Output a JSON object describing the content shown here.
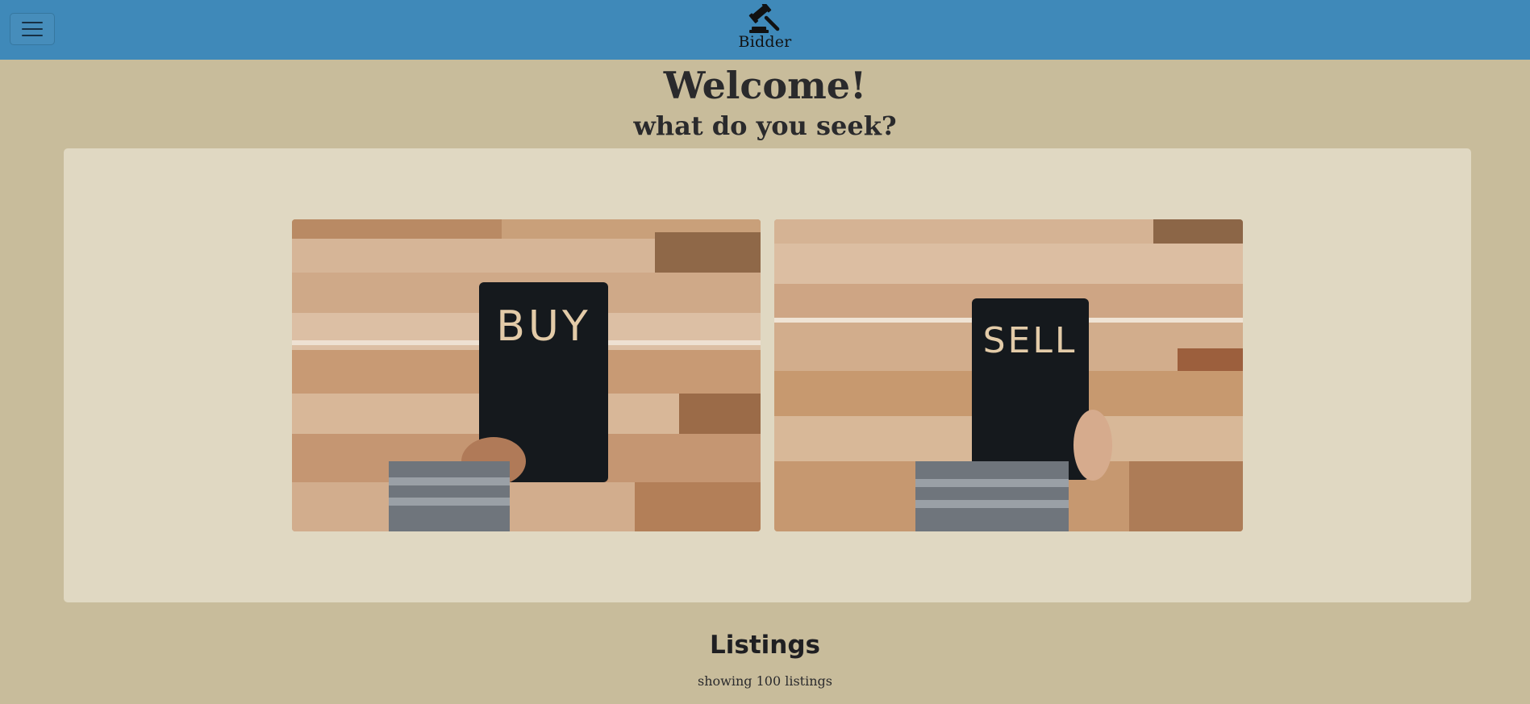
{
  "navbar": {
    "brand_name": "Bidder",
    "brand_icon": "gavel-icon",
    "menu_icon": "hamburger-icon",
    "background_color": "#3f89b9"
  },
  "hero": {
    "title": "Welcome!",
    "subtitle": "what do you seek?"
  },
  "choices": [
    {
      "label": "BUY",
      "image": "hand-holding-buy-card"
    },
    {
      "label": "SELL",
      "image": "hand-holding-sell-card"
    }
  ],
  "listings": {
    "title": "Listings",
    "count_text": "showing 100 listings"
  },
  "colors": {
    "page_background": "#c8bc9b",
    "panel_background": "#e0d8c2"
  }
}
